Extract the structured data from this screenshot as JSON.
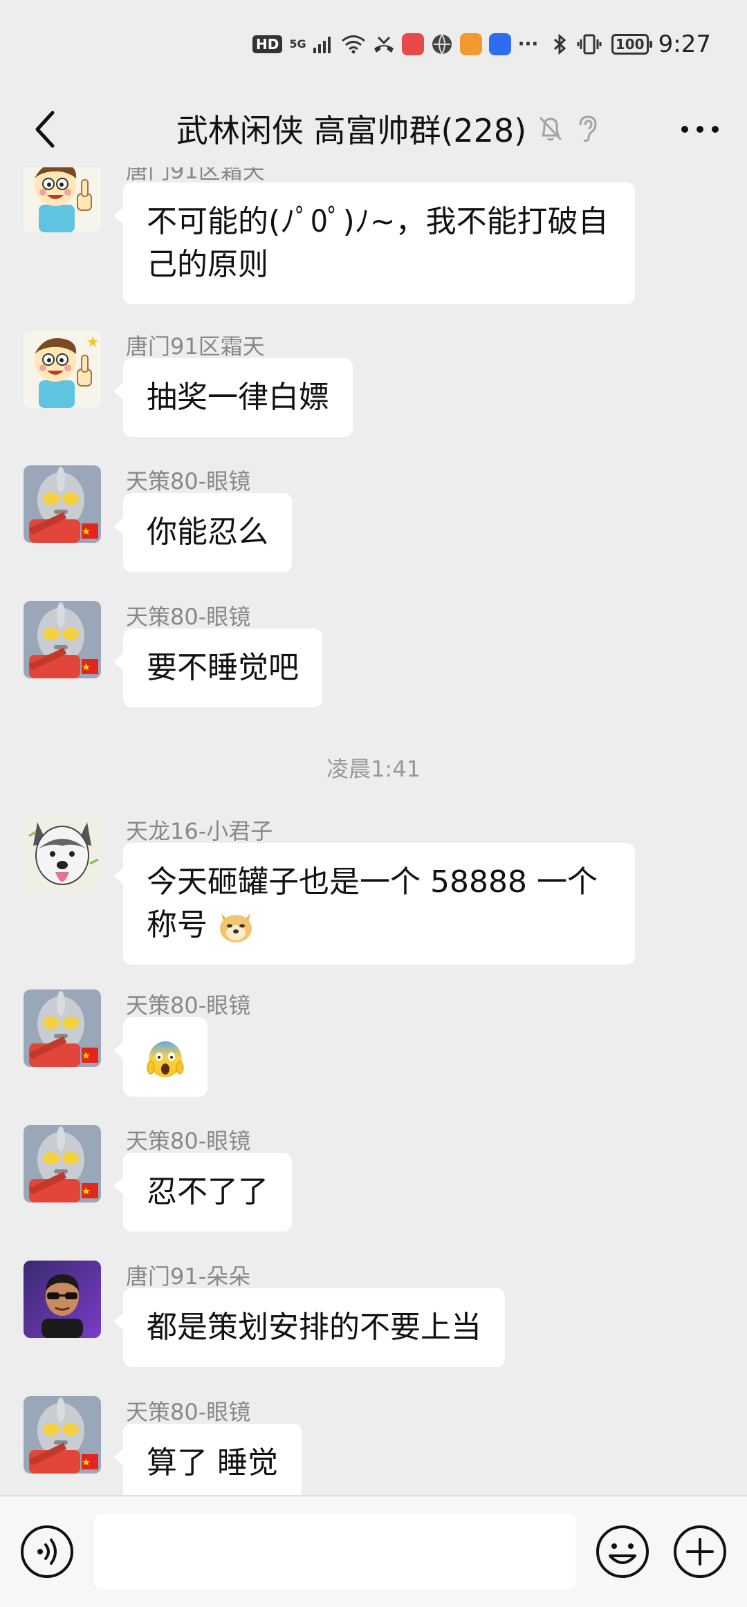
{
  "status_bar": {
    "hd_label": "HD",
    "network_label": "5G",
    "more_label": "···",
    "battery_label": "100",
    "time": "9:27"
  },
  "header": {
    "title": "武林闲侠 高富帅群(228)"
  },
  "messages": [
    {
      "sender": "唐门91区霜天",
      "text": "不可能的(ﾉﾟ0ﾟ)ﾉ~，我不能打破自己的原则",
      "avatar_icon": "cartoon-boy-thumbs-up-avatar"
    },
    {
      "sender": "唐门91区霜天",
      "text": "抽奖一律白嫖",
      "avatar_icon": "cartoon-boy-thumbs-up-avatar"
    },
    {
      "sender": "天策80-眼镜",
      "text": "你能忍么",
      "avatar_icon": "ultraman-avatar"
    },
    {
      "sender": "天策80-眼镜",
      "text": "要不睡觉吧",
      "avatar_icon": "ultraman-avatar"
    },
    {
      "sender": "天龙16-小君子",
      "text": "今天砸罐子也是一个 58888 一个称号",
      "trailing_emoji": "doge-emoji",
      "avatar_icon": "husky-dog-avatar"
    },
    {
      "sender": "天策80-眼镜",
      "text": "",
      "emoji": "scream-emoji",
      "avatar_icon": "ultraman-avatar"
    },
    {
      "sender": "天策80-眼镜",
      "text": "忍不了了",
      "avatar_icon": "ultraman-avatar"
    },
    {
      "sender": "唐门91-朵朵",
      "text": "都是策划安排的不要上当",
      "avatar_icon": "person-sunglasses-avatar"
    },
    {
      "sender": "天策80-眼镜",
      "text": "算了 睡觉",
      "avatar_icon": "ultraman-avatar"
    }
  ],
  "time_separator": "凌晨1:41",
  "input": {
    "value": "",
    "placeholder": ""
  },
  "colors": {
    "background": "#ededed",
    "bubble": "#ffffff",
    "sender_text": "#888888"
  }
}
